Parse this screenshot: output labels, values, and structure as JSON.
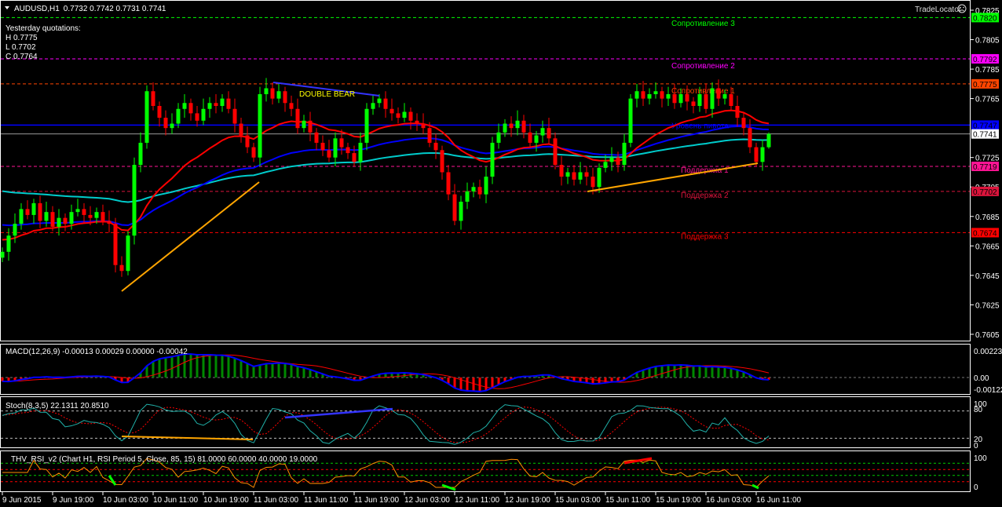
{
  "header": {
    "symbol": "AUDUSD,H1",
    "ohlc": "0.7732 0.7742 0.7731 0.7741"
  },
  "yesterday": {
    "title": "Yesterday quotations:",
    "h": "H 0.7775",
    "l": "L 0.7702",
    "c": "C 0.7764"
  },
  "brand": "TradeLocator",
  "annotation": "DOUBLE  BEAR",
  "levels": [
    {
      "label": "Сопротивление 3",
      "price": 0.782,
      "tag": "0.7820",
      "color": "#00ff00",
      "tagText": "#000"
    },
    {
      "label": "Сопротивление 2",
      "price": 0.7792,
      "tag": "0.7792",
      "color": "#ff00ff",
      "tagText": "#000"
    },
    {
      "label": "Сопротивление 1",
      "price": 0.7775,
      "tag": "0.7775",
      "color": "#ff4500",
      "tagText": "#000"
    },
    {
      "label": "Уровень пивота",
      "price": 0.7747,
      "tag": "0.7747",
      "color": "#0000ff",
      "tagText": "#000"
    },
    {
      "label": "Поддержка 1",
      "price": 0.7719,
      "tag": "0.7719",
      "color": "#ff1493",
      "tagText": "#000"
    },
    {
      "label": "Поддержка 2",
      "price": 0.7702,
      "tag": "0.7702",
      "color": "#dc143c",
      "tagText": "#000"
    },
    {
      "label": "Поддержка 3",
      "price": 0.7674,
      "tag": "0.7674",
      "color": "#ff0000",
      "tagText": "#000"
    }
  ],
  "bid": {
    "price": 0.7741,
    "tag": "0.7741"
  },
  "macd_label": "MACD(12,26,9) -0.00013 0.00029 0.00000 -0.00042",
  "macd_axis": [
    "0.00223",
    "0.00",
    "-0.00122"
  ],
  "stoch_label": "Stoch(8,3,5) 22.1311 20.8510",
  "stoch_axis": [
    "100",
    "80",
    "20",
    "0"
  ],
  "rsi_label": "THV_RSI_v2   (Chart H1,  RSI Period 5,  Close,  85,  15)   81.0000 60.0000 40.0000 19.0000",
  "rsi_axis": [
    "100",
    "0"
  ],
  "chart_data": {
    "type": "candlestick",
    "title": "AUDUSD,H1",
    "ylim": [
      0.7595,
      0.783
    ],
    "yticks": [
      "0.7825",
      "0.7805",
      "0.7785",
      "0.7765",
      "0.7725",
      "0.7705",
      "0.7685",
      "0.7665",
      "0.7645",
      "0.7625",
      "0.7605"
    ],
    "xticks": [
      "9 Jun 2015",
      "9 Jun 19:00",
      "10 Jun 03:00",
      "10 Jun 11:00",
      "10 Jun 19:00",
      "11 Jun 03:00",
      "11 Jun 11:00",
      "11 Jun 19:00",
      "12 Jun 03:00",
      "12 Jun 11:00",
      "12 Jun 19:00",
      "15 Jun 03:00",
      "15 Jun 11:00",
      "15 Jun 19:00",
      "16 Jun 03:00",
      "16 Jun 11:00"
    ],
    "closes": [
      0.7661,
      0.7672,
      0.768,
      0.769,
      0.7686,
      0.7694,
      0.7682,
      0.7688,
      0.7678,
      0.7684,
      0.768,
      0.7688,
      0.769,
      0.7686,
      0.7684,
      0.7688,
      0.7682,
      0.768,
      0.7652,
      0.7648,
      0.7672,
      0.772,
      0.7735,
      0.777,
      0.776,
      0.7752,
      0.7745,
      0.7748,
      0.7758,
      0.7762,
      0.7755,
      0.775,
      0.7758,
      0.7762,
      0.776,
      0.7765,
      0.7758,
      0.7748,
      0.774,
      0.7732,
      0.7725,
      0.7768,
      0.7772,
      0.7765,
      0.777,
      0.7762,
      0.7758,
      0.7745,
      0.775,
      0.7742,
      0.7735,
      0.773,
      0.7725,
      0.7738,
      0.7732,
      0.7728,
      0.7722,
      0.7735,
      0.7758,
      0.7762,
      0.7765,
      0.7758,
      0.7755,
      0.7752,
      0.7756,
      0.775,
      0.7748,
      0.7745,
      0.7735,
      0.773,
      0.7715,
      0.77,
      0.7682,
      0.7695,
      0.7702,
      0.7705,
      0.77,
      0.7712,
      0.7735,
      0.7742,
      0.7748,
      0.7745,
      0.775,
      0.7742,
      0.7735,
      0.774,
      0.7745,
      0.7738,
      0.772,
      0.7712,
      0.7715,
      0.771,
      0.7715,
      0.7712,
      0.7705,
      0.7718,
      0.7722,
      0.7725,
      0.772,
      0.7735,
      0.7765,
      0.777,
      0.7765,
      0.7768,
      0.777,
      0.7765,
      0.7768,
      0.7762,
      0.7768,
      0.7763,
      0.776,
      0.7768,
      0.7758,
      0.7772,
      0.7765,
      0.7768,
      0.776,
      0.7752,
      0.7745,
      0.7732,
      0.7722,
      0.7732,
      0.7741
    ],
    "last_bar": {
      "open": 0.7732,
      "high": 0.7742,
      "low": 0.7731,
      "close": 0.7741
    },
    "colors": {
      "up": "#00ff00",
      "down": "#ff0000",
      "ma_fast": "#ff0000",
      "ma_mid": "#0000ff",
      "ma_slow": "#00cccc"
    }
  }
}
